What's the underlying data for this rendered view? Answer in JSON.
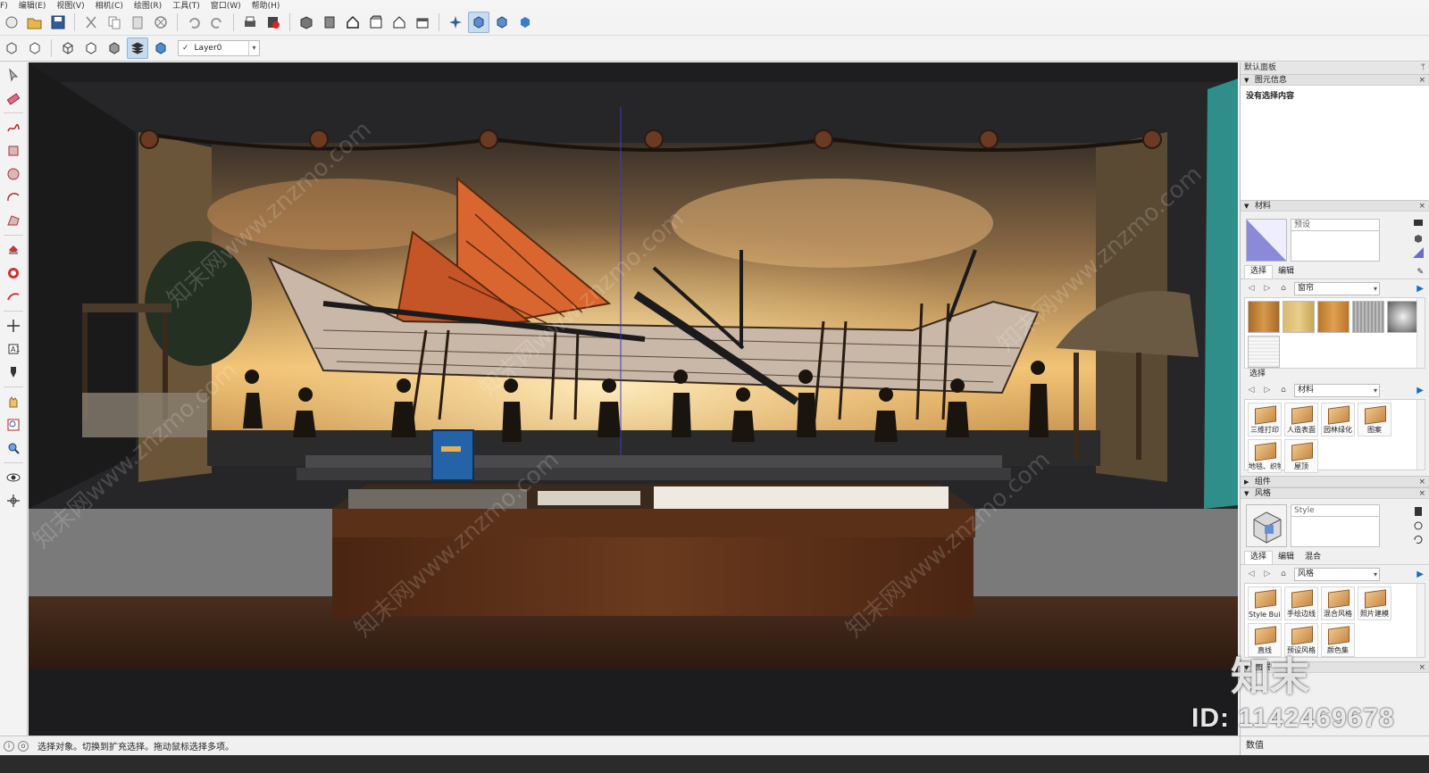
{
  "menu": [
    "F)",
    "编辑(E)",
    "视图(V)",
    "相机(C)",
    "绘图(R)",
    "工具(T)",
    "窗口(W)",
    "帮助(H)"
  ],
  "toolbar": {
    "layer_label": "Layer0",
    "layer_checked": "✓"
  },
  "viewport": {
    "watermarks": [
      "知末网www.znzmo.com",
      "知末网www.znzmo.com",
      "知末网www.znzmo.com",
      "知末网www.znzmo.com",
      "知末网www.znzmo.com",
      "知末网www.znzmo.com"
    ],
    "id_tag": "ID: 1142469678",
    "logo_text": "知末"
  },
  "tray": {
    "title": "默认面板",
    "entity_info": {
      "header": "图元信息",
      "body": "没有选择内容"
    },
    "materials": {
      "header": "材料",
      "name_placeholder": "预设",
      "tabs": [
        "选择",
        "编辑"
      ],
      "dropdown1": "窗帘",
      "select_label": "选择",
      "dropdown2": "材料",
      "items": [
        "三维打印",
        "人造表面",
        "园林绿化",
        "图案",
        "地毯、织物",
        "屋顶"
      ]
    },
    "components": {
      "header": "组件"
    },
    "styles": {
      "header": "风格",
      "style_name": "Style",
      "tabs": [
        "选择",
        "编辑",
        "混合"
      ],
      "dropdown": "风格",
      "items": [
        "Style Builder",
        "手绘边线",
        "混合风格",
        "照片建模",
        "直线",
        "预设风格",
        "颜色集"
      ]
    },
    "layers": {
      "header": "图层"
    }
  },
  "status": {
    "message": "选择对象。切换到扩充选择。拖动鼠标选择多项。",
    "value_label": "数值"
  },
  "colors": {
    "sky_top": "#3a3128",
    "sky_glow": "#f2c476",
    "sail": "#d9662e",
    "floor": "#3a2418",
    "cabinet": "#5a3019"
  }
}
